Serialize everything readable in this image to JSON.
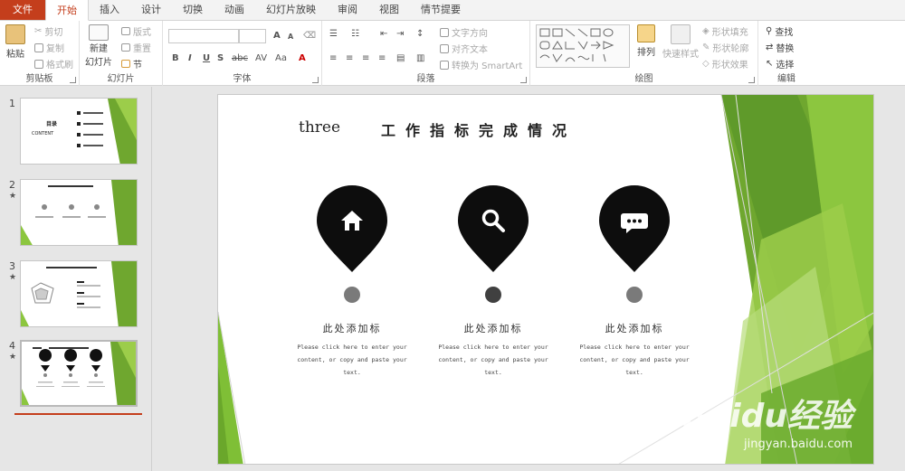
{
  "tabs": [
    "文件",
    "开始",
    "插入",
    "设计",
    "切换",
    "动画",
    "幻灯片放映",
    "审阅",
    "视图",
    "情节提要"
  ],
  "ribbon": {
    "clipboard": {
      "label": "剪贴板",
      "paste": "粘贴",
      "cut": "剪切",
      "copy": "复制",
      "format_painter": "格式刷"
    },
    "slides": {
      "label": "幻灯片",
      "new_slide_line1": "新建",
      "new_slide_line2": "幻灯片",
      "layout": "版式",
      "reset": "重置",
      "section": "节"
    },
    "font": {
      "label": "字体",
      "bold": "B",
      "italic": "I",
      "underline": "U",
      "strike": "S",
      "spacing": "abc",
      "case": "AV",
      "grow": "A",
      "shrink": "A",
      "color": "A"
    },
    "paragraph": {
      "label": "段落",
      "text_direction": "文字方向",
      "align_text": "对齐文本",
      "smartart": "转换为 SmartArt"
    },
    "drawing": {
      "label": "绘图",
      "arrange": "排列",
      "quick_styles": "快速样式",
      "shape_fill": "形状填充",
      "shape_outline": "形状轮廓",
      "shape_effects": "形状效果"
    },
    "editing": {
      "label": "编辑",
      "find": "查找",
      "replace": "替换",
      "select": "选择"
    }
  },
  "thumbnails": [
    {
      "num": "1",
      "star": "",
      "title_cn": "目录",
      "title_en": "CONTENT"
    },
    {
      "num": "2",
      "star": "★"
    },
    {
      "num": "3",
      "star": "★"
    },
    {
      "num": "4",
      "star": "★"
    }
  ],
  "slide": {
    "section_word": "three",
    "title": "工作指标完成情况",
    "columns": [
      {
        "heading": "此处添加标",
        "icon": "home-icon",
        "line1": "Please click here to enter your",
        "line2": "content, or copy and paste your",
        "line3": "text."
      },
      {
        "heading": "此处添加标",
        "icon": "search-icon",
        "line1": "Please click here to enter your",
        "line2": "content, or copy and paste your",
        "line3": "text."
      },
      {
        "heading": "此处添加标",
        "icon": "chat-icon",
        "line1": "Please click here to enter your",
        "line2": "content, or copy and paste your",
        "line3": "text."
      }
    ],
    "accent": "#8cc63f",
    "accent_dark": "#5e9c2b"
  },
  "watermark": {
    "main": "Baidu经验",
    "sub": "jingyan.baidu.com"
  }
}
